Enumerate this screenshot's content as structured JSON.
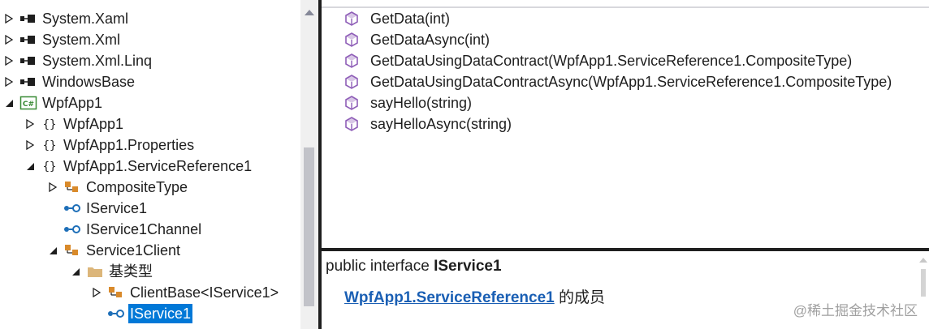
{
  "tree": {
    "items": [
      {
        "label": "System.Xaml",
        "icon": "assembly-icon",
        "expander": "closed"
      },
      {
        "label": "System.Xml",
        "icon": "assembly-icon",
        "expander": "closed"
      },
      {
        "label": "System.Xml.Linq",
        "icon": "assembly-icon",
        "expander": "closed"
      },
      {
        "label": "WindowsBase",
        "icon": "assembly-icon",
        "expander": "closed"
      },
      {
        "label": "WpfApp1",
        "icon": "csharp-project-icon",
        "expander": "open"
      },
      {
        "label": "WpfApp1",
        "icon": "namespace-icon",
        "expander": "closed"
      },
      {
        "label": "WpfApp1.Properties",
        "icon": "namespace-icon",
        "expander": "closed"
      },
      {
        "label": "WpfApp1.ServiceReference1",
        "icon": "namespace-icon",
        "expander": "open"
      },
      {
        "label": "CompositeType",
        "icon": "class-icon",
        "expander": "closed"
      },
      {
        "label": "IService1",
        "icon": "interface-icon",
        "expander": "none"
      },
      {
        "label": "IService1Channel",
        "icon": "interface-icon",
        "expander": "none"
      },
      {
        "label": "Service1Client",
        "icon": "class-icon",
        "expander": "open"
      },
      {
        "label": "基类型",
        "icon": "folder-icon",
        "expander": "open"
      },
      {
        "label": "ClientBase<IService1>",
        "icon": "class-icon",
        "expander": "closed"
      },
      {
        "label": "IService1",
        "icon": "interface-icon",
        "expander": "none",
        "selected": true
      }
    ]
  },
  "members": [
    {
      "label": "GetData(int)",
      "icon": "method-icon"
    },
    {
      "label": "GetDataAsync(int)",
      "icon": "method-icon"
    },
    {
      "label": "GetDataUsingDataContract(WpfApp1.ServiceReference1.CompositeType)",
      "icon": "method-icon"
    },
    {
      "label": "GetDataUsingDataContractAsync(WpfApp1.ServiceReference1.CompositeType)",
      "icon": "method-icon"
    },
    {
      "label": "sayHello(string)",
      "icon": "method-icon"
    },
    {
      "label": "sayHelloAsync(string)",
      "icon": "method-icon"
    }
  ],
  "description": {
    "prefix": "public interface ",
    "name": "IService1",
    "link": "WpfApp1.ServiceReference1",
    "suffix": " 的成员"
  },
  "watermark": "@稀土掘金技术社区",
  "colors": {
    "selection": "#0078d7",
    "link": "#1a5fb4",
    "method": "#8f5fb8",
    "class": "#d98a2b",
    "interface": "#1e6fb8"
  }
}
